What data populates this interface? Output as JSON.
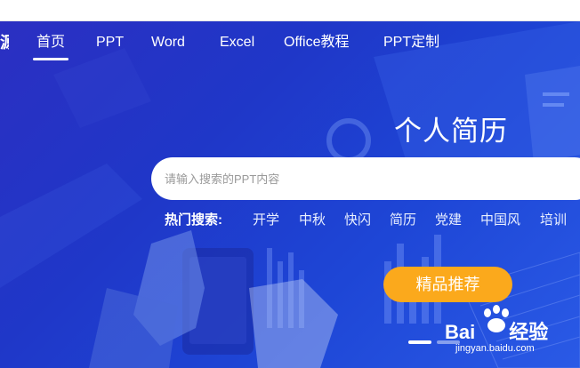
{
  "nav": {
    "logo_fragment": "源",
    "items": [
      {
        "label": "首页",
        "active": true
      },
      {
        "label": "PPT",
        "active": false
      },
      {
        "label": "Word",
        "active": false
      },
      {
        "label": "Excel",
        "active": false
      },
      {
        "label": "Office教程",
        "active": false
      },
      {
        "label": "PPT定制",
        "active": false
      }
    ]
  },
  "hero": {
    "title": "个人简历",
    "search_placeholder": "请输入搜索的PPT内容",
    "hot_label": "热门搜索:",
    "hot_tags": [
      "开学",
      "中秋",
      "快闪",
      "简历",
      "党建",
      "中国风",
      "培训"
    ],
    "cta_label": "精品推荐"
  },
  "watermark": {
    "brand_left": "Bai",
    "brand_right": "经验",
    "url": "jingyan.baidu.com"
  },
  "colors": {
    "hero_bg": "#1f3fcf",
    "accent": "#fba91c",
    "text": "#ffffff"
  }
}
